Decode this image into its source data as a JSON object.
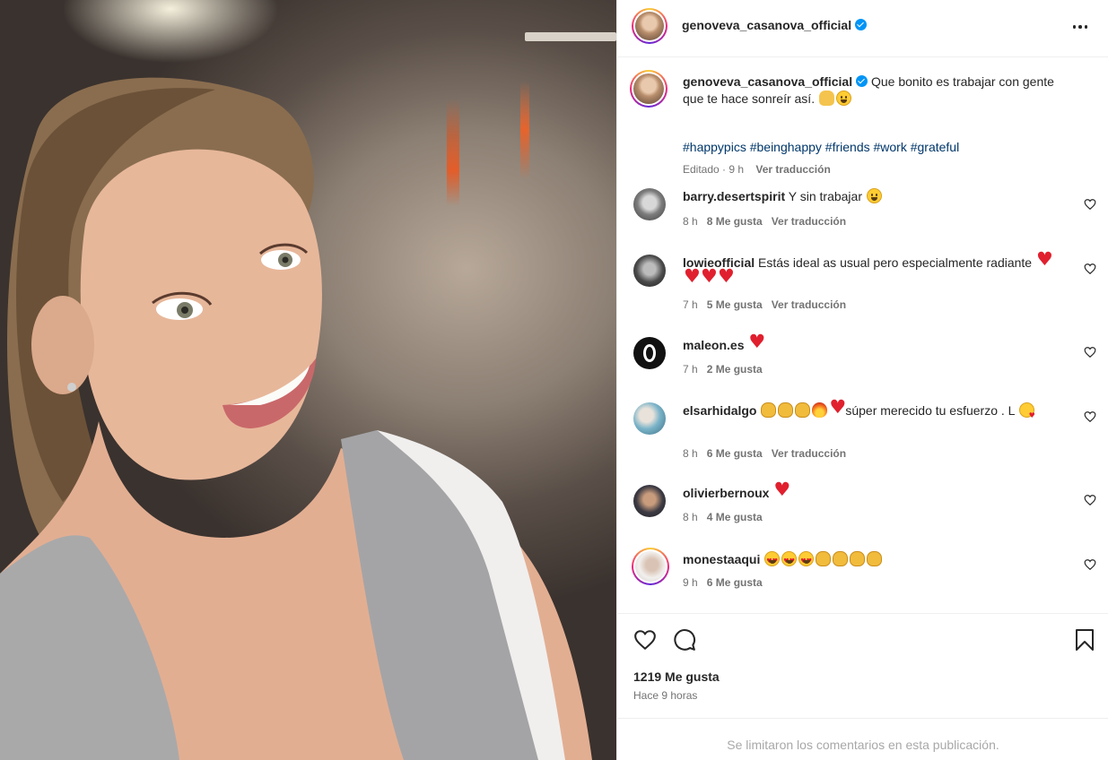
{
  "post": {
    "author": "genoveva_casanova_official",
    "caption": "Que bonito es trabajar con gente que te hace sonreír así.",
    "hashtags": "#happypics #beinghappy #friends #work #grateful",
    "edited": "Editado",
    "time": "9 h",
    "translate": "Ver traducción"
  },
  "comments": [
    {
      "user": "barry.desertspirit",
      "text": "Y sin trabajar",
      "time": "8 h",
      "likes": "8 Me gusta",
      "translate": "Ver traducción"
    },
    {
      "user": "lowieofficial",
      "text": "Estás ideal as usual pero especialmente radiante",
      "time": "7 h",
      "likes": "5 Me gusta",
      "translate": "Ver traducción"
    },
    {
      "user": "maleon.es",
      "text": "",
      "time": "7 h",
      "likes": "2 Me gusta"
    },
    {
      "user": "elsarhidalgo",
      "text": "súper merecido tu esfuerzo . L",
      "time": "8 h",
      "likes": "6 Me gusta",
      "translate": "Ver traducción"
    },
    {
      "user": "olivierbernoux",
      "text": "",
      "time": "8 h",
      "likes": "4 Me gusta"
    },
    {
      "user": "monestaaqui",
      "text": "",
      "time": "9 h",
      "likes": "6 Me gusta"
    }
  ],
  "footer": {
    "likes": "1219 Me gusta",
    "posted": "Hace 9 horas",
    "limited": "Se limitaron los comentarios en esta publicación."
  },
  "icons": {
    "verified": "verified-badge-icon",
    "more": "more-options-icon",
    "like": "heart-icon",
    "comment": "comment-bubble-icon",
    "save": "bookmark-icon"
  },
  "colors": {
    "link": "#00376b",
    "muted": "#737373",
    "verified": "#0095f6"
  }
}
